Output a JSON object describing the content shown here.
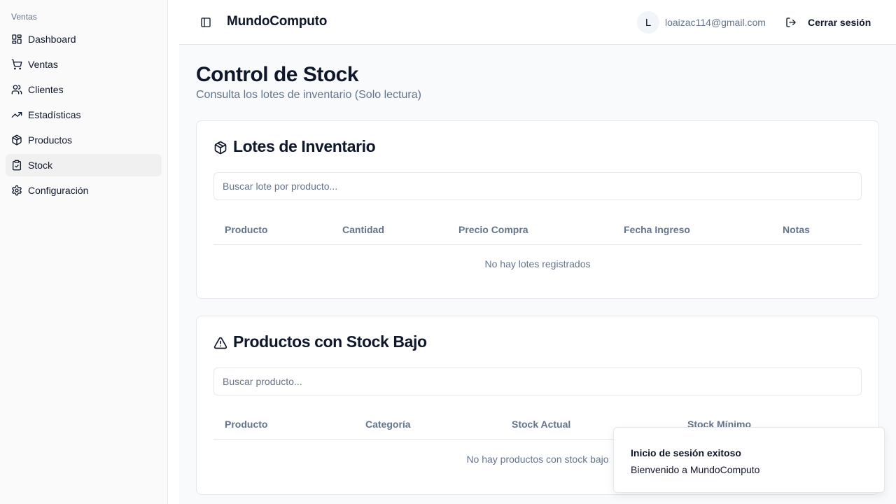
{
  "sidebar": {
    "group_label": "Ventas",
    "items": [
      {
        "label": "Dashboard",
        "icon": "dashboard-icon"
      },
      {
        "label": "Ventas",
        "icon": "cart-icon"
      },
      {
        "label": "Clientes",
        "icon": "users-icon"
      },
      {
        "label": "Estadísticas",
        "icon": "trending-up-icon"
      },
      {
        "label": "Productos",
        "icon": "package-icon"
      },
      {
        "label": "Stock",
        "icon": "clipboard-check-icon",
        "active": true
      },
      {
        "label": "Configuración",
        "icon": "gear-icon"
      }
    ]
  },
  "header": {
    "brand": "MundoComputo",
    "avatar_initial": "L",
    "user_email": "loaizac114@gmail.com",
    "logout_label": "Cerrar sesión"
  },
  "page": {
    "title": "Control de Stock",
    "subtitle": "Consulta los lotes de inventario (Solo lectura)"
  },
  "lots_card": {
    "title": "Lotes de Inventario",
    "search_placeholder": "Buscar lote por producto...",
    "columns": [
      "Producto",
      "Cantidad",
      "Precio Compra",
      "Fecha Ingreso",
      "Notas"
    ],
    "empty_message": "No hay lotes registrados"
  },
  "low_stock_card": {
    "title": "Productos con Stock Bajo",
    "search_placeholder": "Buscar producto...",
    "columns": [
      "Producto",
      "Categoría",
      "Stock Actual",
      "Stock Mínimo"
    ],
    "empty_message": "No hay productos con stock bajo"
  },
  "toast": {
    "title": "Inicio de sesión exitoso",
    "description": "Bienvenido a MundoComputo"
  }
}
